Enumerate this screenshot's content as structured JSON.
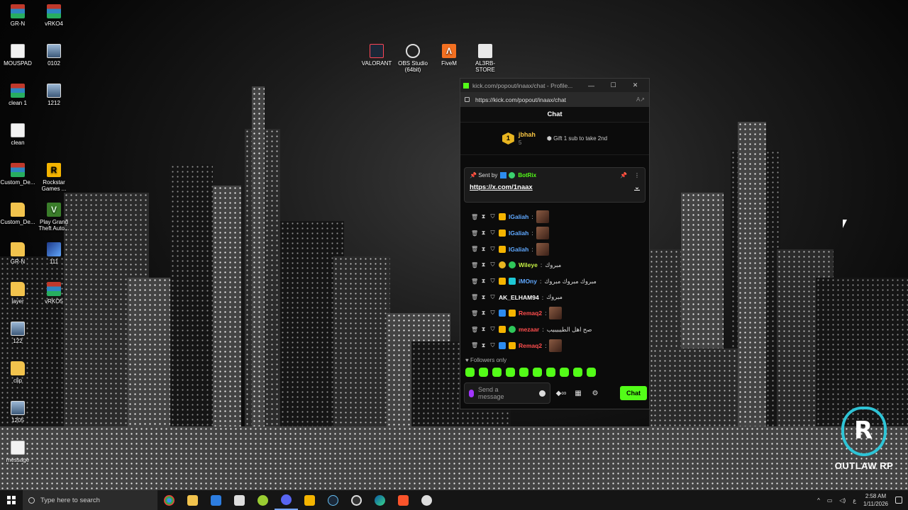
{
  "desktop_icons": [
    {
      "label": "GR-N",
      "kind": "rar"
    },
    {
      "label": "vRKO4",
      "kind": "rar"
    },
    {
      "label": "MOUSPAD",
      "kind": "doc"
    },
    {
      "label": "0102",
      "kind": "img"
    },
    {
      "label": "clean 1",
      "kind": "rar"
    },
    {
      "label": "1212",
      "kind": "img"
    },
    {
      "label": "clean",
      "kind": "doc"
    },
    {
      "label": "Custom_De...",
      "kind": "rar"
    },
    {
      "label": "Rockstar Games ...",
      "kind": "rockstar"
    },
    {
      "label": "Custom_De...",
      "kind": "folder"
    },
    {
      "label": "Play Grand Theft Auto...",
      "kind": "gta"
    },
    {
      "label": "GR-N",
      "kind": "folder"
    },
    {
      "label": "111",
      "kind": "app111"
    },
    {
      "label": "layer",
      "kind": "folder"
    },
    {
      "label": "vRKO5",
      "kind": "rar"
    },
    {
      "label": "122",
      "kind": "img"
    },
    {
      "label": "clip",
      "kind": "folder"
    },
    {
      "label": "1205",
      "kind": "img"
    },
    {
      "label": "message",
      "kind": "doc"
    },
    {
      "label": "VALORANT",
      "kind": "val"
    },
    {
      "label": "OBS Studio (64bit)",
      "kind": "obs"
    },
    {
      "label": "FiveM",
      "kind": "fivem"
    },
    {
      "label": "AL3RB-STORE",
      "kind": "store"
    }
  ],
  "browser": {
    "title": "kick.com/popout/inaax/chat - Profile...",
    "url": "https://kick.com/popout/inaax/chat",
    "minimize": "—",
    "maximize": "☐",
    "close": "✕",
    "reader_icon": "A↗"
  },
  "chat": {
    "header": "Chat",
    "leaderboard": {
      "rank": "1",
      "name": "jbhah",
      "count": "5",
      "gift_label": "Gift 1 sub to take 2nd"
    },
    "pinned": {
      "sent_by": "Sent by",
      "sender": "BotRix",
      "link": "https://x.com/1naax"
    },
    "messages": [
      {
        "user": "IGaliah",
        "color": "#5fa8ff",
        "text": "",
        "emote": true,
        "badges": [
          "crown"
        ]
      },
      {
        "user": "IGaliah",
        "color": "#5fa8ff",
        "text": "",
        "emote": true,
        "badges": [
          "crown"
        ]
      },
      {
        "user": "IGaliah",
        "color": "#5fa8ff",
        "text": "",
        "emote": true,
        "badges": [
          "crown"
        ]
      },
      {
        "user": "Wileye",
        "color": "#c6f244",
        "text": "مبروك",
        "emote": false,
        "badges": [
          "gold",
          "green"
        ]
      },
      {
        "user": "iMOny",
        "color": "#5fa8ff",
        "text": "مبروك مبروك مبروك",
        "emote": false,
        "badges": [
          "crown",
          "cyan"
        ]
      },
      {
        "user": "AK_ELHAM94",
        "color": "#ffffff",
        "text": "مبروك",
        "emote": false,
        "badges": []
      },
      {
        "user": "Remaq2",
        "color": "#ff4d4d",
        "text": "",
        "emote": true,
        "badges": [
          "blue",
          "crown"
        ]
      },
      {
        "user": "mezaar",
        "color": "#ff4d4d",
        "text": "صح اهل الطيبيبيب",
        "emote": false,
        "badges": [
          "crown",
          "green"
        ]
      },
      {
        "user": "Remaq2",
        "color": "#ff4d4d",
        "text": "",
        "emote": true,
        "badges": [
          "blue",
          "crown"
        ]
      }
    ],
    "followers_only": "Followers only",
    "input_placeholder": "Send a message",
    "send_label": "Chat",
    "colors": {
      "kick_green": "#53fc18",
      "leader_gold": "#f5c342"
    }
  },
  "watermark": {
    "mark": "R",
    "text": "OUTLAW RP"
  },
  "taskbar": {
    "search_placeholder": "Type here to search",
    "apps": [
      "files-app",
      "chrome",
      "file-explorer",
      "microsoft-store",
      "mail",
      "app-green",
      "discord",
      "rockstar-launcher",
      "steam",
      "obs",
      "edge",
      "brave",
      "app-white"
    ],
    "time": "2:58 AM",
    "date": "1/11/2026",
    "lang": "ع",
    "tray_arrow": "^"
  }
}
